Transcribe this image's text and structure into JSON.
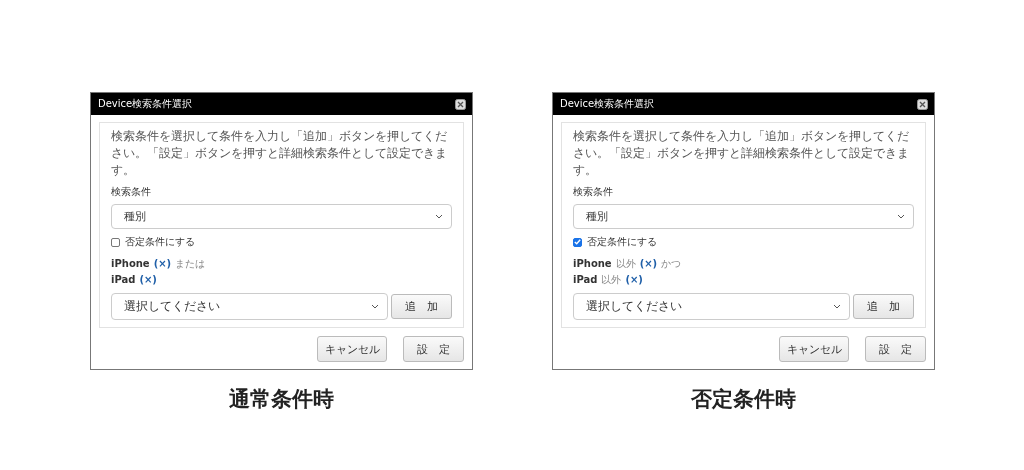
{
  "panels": [
    {
      "caption": "通常条件時",
      "dialog": {
        "title": "Device検索条件選択",
        "description": "検索条件を選択して条件を入力し「追加」ボタンを押してください。「設定」ボタンを押すと詳細検索条件として設定できます。",
        "field_label": "検索条件",
        "condition_select": "種別",
        "negate": {
          "label": "否定条件にする",
          "checked": false
        },
        "conditions": [
          {
            "name": "iPhone",
            "remove": "(×)",
            "joiner": "または"
          },
          {
            "name": "iPad",
            "remove": "(×)"
          }
        ],
        "value_select": "選択してください",
        "add_button": "追　加",
        "buttons": [
          "キャンセル",
          "設　定"
        ]
      }
    },
    {
      "caption": "否定条件時",
      "dialog": {
        "title": "Device検索条件選択",
        "description": "検索条件を選択して条件を入力し「追加」ボタンを押してください。「設定」ボタンを押すと詳細検索条件として設定できます。",
        "field_label": "検索条件",
        "condition_select": "種別",
        "negate": {
          "label": "否定条件にする",
          "checked": true
        },
        "conditions": [
          {
            "name": "iPhone",
            "qualifier": "以外",
            "remove": "(×)",
            "joiner": "かつ"
          },
          {
            "name": "iPad",
            "qualifier": "以外",
            "remove": "(×)"
          }
        ],
        "value_select": "選択してください",
        "add_button": "追　加",
        "buttons": [
          "キャンセル",
          "設　定"
        ]
      }
    }
  ]
}
